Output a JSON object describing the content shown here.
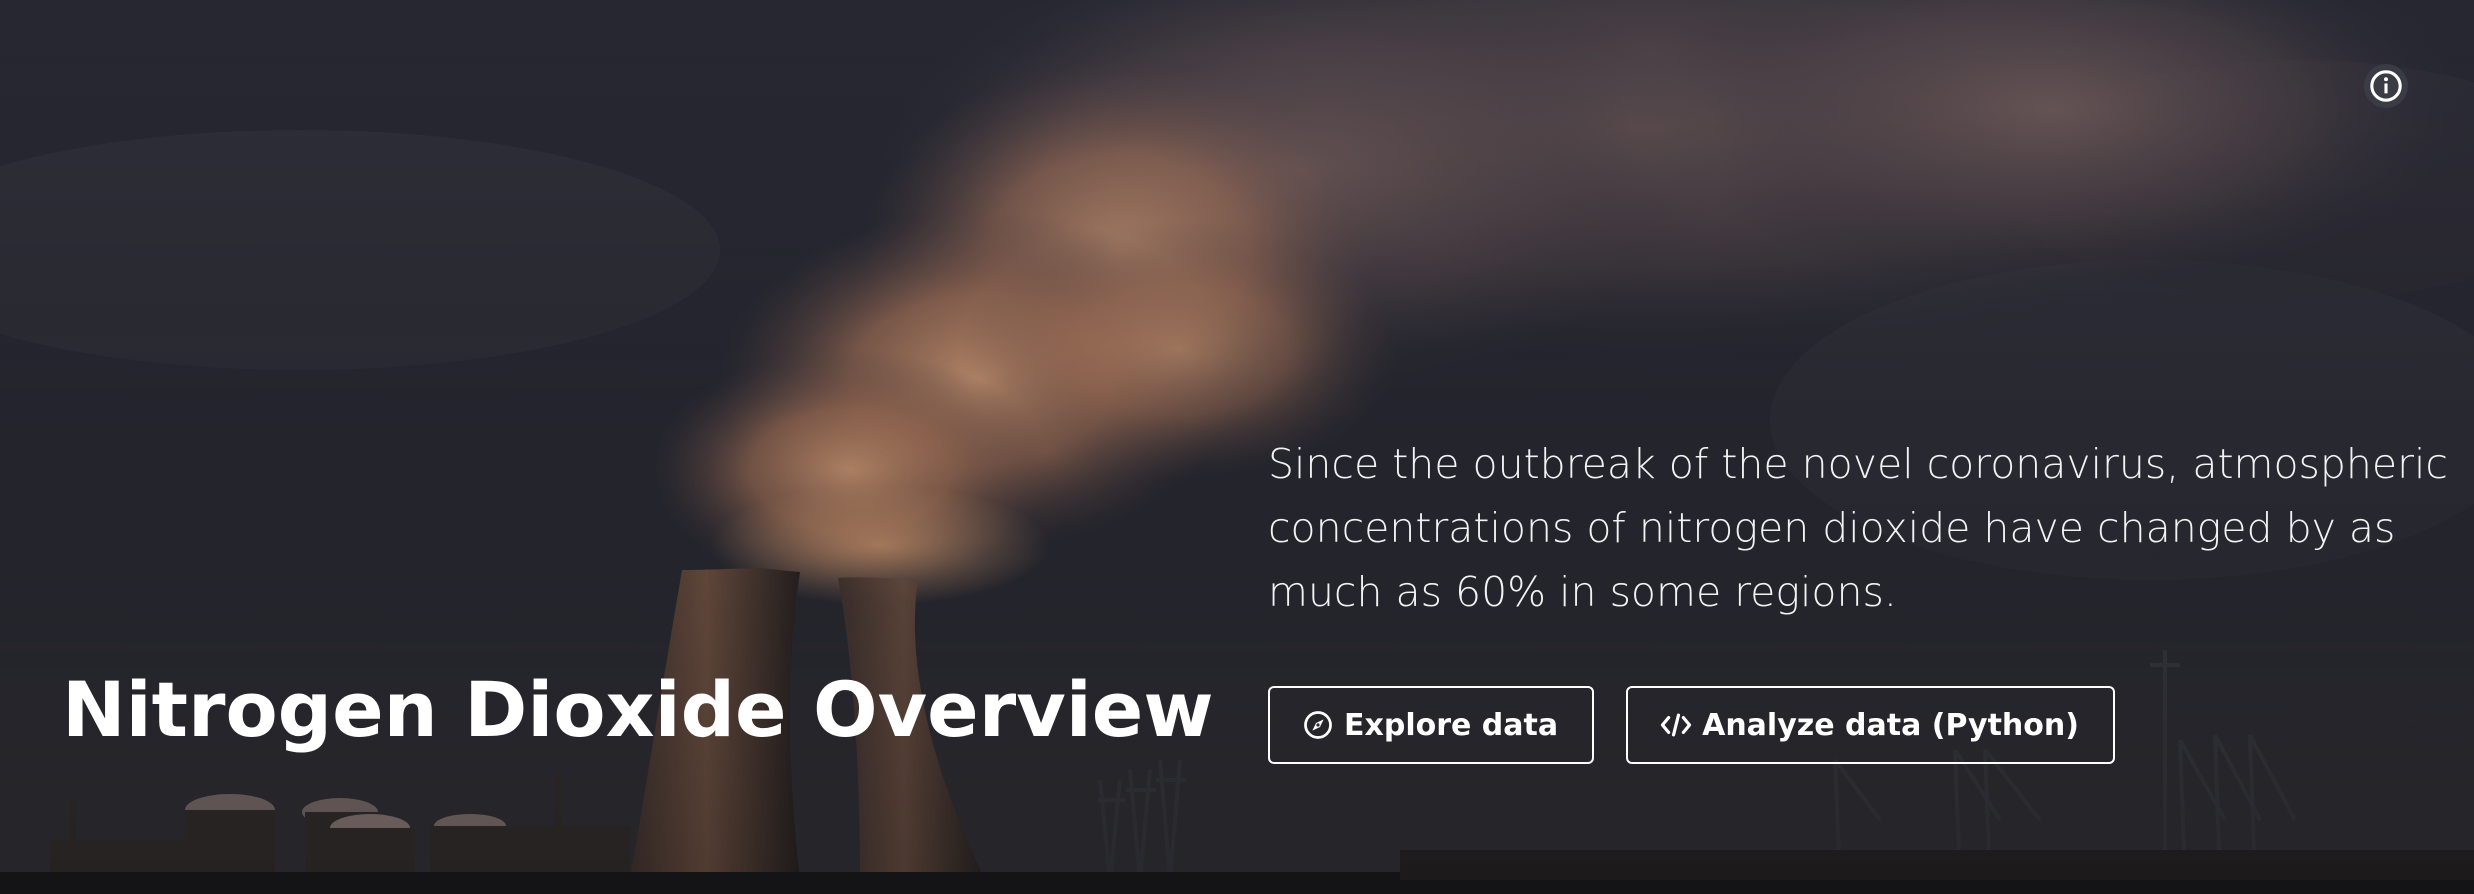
{
  "hero": {
    "title": "Nitrogen Dioxide Overview",
    "description": "Since the outbreak of the novel coronavirus, atmospheric concentrations of nitrogen dioxide have changed by as much as 60% in some regions.",
    "info_icon": "info-circle-icon",
    "buttons": [
      {
        "label": "Explore data",
        "icon": "compass-icon"
      },
      {
        "label": "Analyze data (Python)",
        "icon": "code-icon"
      }
    ]
  },
  "colors": {
    "sky": "#2a2b33",
    "smoke": "#b58466",
    "text": "#ffffff"
  }
}
